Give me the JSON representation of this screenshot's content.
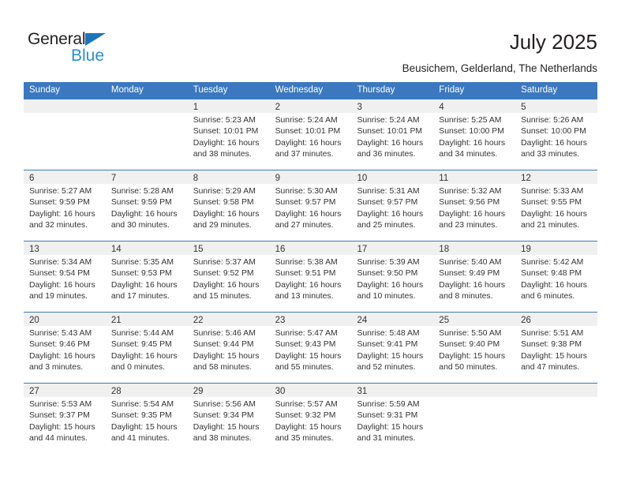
{
  "brand": {
    "name_part1": "General",
    "name_part2": "Blue",
    "color_dark": "#231f20",
    "color_blue": "#2a8fd4",
    "triangle_color": "#1b75bb"
  },
  "header": {
    "title": "July 2025",
    "subtitle": "Beusichem, Gelderland, The Netherlands",
    "accent_color": "#3b78bf",
    "daynum_strip_color": "#f0f0f0"
  },
  "weekday_headers": [
    "Sunday",
    "Monday",
    "Tuesday",
    "Wednesday",
    "Thursday",
    "Friday",
    "Saturday"
  ],
  "weeks": [
    [
      {
        "day": "",
        "sunrise": "",
        "sunset": "",
        "daylight_l1": "",
        "daylight_l2": "",
        "empty": true
      },
      {
        "day": "",
        "sunrise": "",
        "sunset": "",
        "daylight_l1": "",
        "daylight_l2": "",
        "empty": true
      },
      {
        "day": "1",
        "sunrise": "Sunrise: 5:23 AM",
        "sunset": "Sunset: 10:01 PM",
        "daylight_l1": "Daylight: 16 hours",
        "daylight_l2": "and 38 minutes.",
        "empty": false
      },
      {
        "day": "2",
        "sunrise": "Sunrise: 5:24 AM",
        "sunset": "Sunset: 10:01 PM",
        "daylight_l1": "Daylight: 16 hours",
        "daylight_l2": "and 37 minutes.",
        "empty": false
      },
      {
        "day": "3",
        "sunrise": "Sunrise: 5:24 AM",
        "sunset": "Sunset: 10:01 PM",
        "daylight_l1": "Daylight: 16 hours",
        "daylight_l2": "and 36 minutes.",
        "empty": false
      },
      {
        "day": "4",
        "sunrise": "Sunrise: 5:25 AM",
        "sunset": "Sunset: 10:00 PM",
        "daylight_l1": "Daylight: 16 hours",
        "daylight_l2": "and 34 minutes.",
        "empty": false
      },
      {
        "day": "5",
        "sunrise": "Sunrise: 5:26 AM",
        "sunset": "Sunset: 10:00 PM",
        "daylight_l1": "Daylight: 16 hours",
        "daylight_l2": "and 33 minutes.",
        "empty": false
      }
    ],
    [
      {
        "day": "6",
        "sunrise": "Sunrise: 5:27 AM",
        "sunset": "Sunset: 9:59 PM",
        "daylight_l1": "Daylight: 16 hours",
        "daylight_l2": "and 32 minutes.",
        "empty": false
      },
      {
        "day": "7",
        "sunrise": "Sunrise: 5:28 AM",
        "sunset": "Sunset: 9:59 PM",
        "daylight_l1": "Daylight: 16 hours",
        "daylight_l2": "and 30 minutes.",
        "empty": false
      },
      {
        "day": "8",
        "sunrise": "Sunrise: 5:29 AM",
        "sunset": "Sunset: 9:58 PM",
        "daylight_l1": "Daylight: 16 hours",
        "daylight_l2": "and 29 minutes.",
        "empty": false
      },
      {
        "day": "9",
        "sunrise": "Sunrise: 5:30 AM",
        "sunset": "Sunset: 9:57 PM",
        "daylight_l1": "Daylight: 16 hours",
        "daylight_l2": "and 27 minutes.",
        "empty": false
      },
      {
        "day": "10",
        "sunrise": "Sunrise: 5:31 AM",
        "sunset": "Sunset: 9:57 PM",
        "daylight_l1": "Daylight: 16 hours",
        "daylight_l2": "and 25 minutes.",
        "empty": false
      },
      {
        "day": "11",
        "sunrise": "Sunrise: 5:32 AM",
        "sunset": "Sunset: 9:56 PM",
        "daylight_l1": "Daylight: 16 hours",
        "daylight_l2": "and 23 minutes.",
        "empty": false
      },
      {
        "day": "12",
        "sunrise": "Sunrise: 5:33 AM",
        "sunset": "Sunset: 9:55 PM",
        "daylight_l1": "Daylight: 16 hours",
        "daylight_l2": "and 21 minutes.",
        "empty": false
      }
    ],
    [
      {
        "day": "13",
        "sunrise": "Sunrise: 5:34 AM",
        "sunset": "Sunset: 9:54 PM",
        "daylight_l1": "Daylight: 16 hours",
        "daylight_l2": "and 19 minutes.",
        "empty": false
      },
      {
        "day": "14",
        "sunrise": "Sunrise: 5:35 AM",
        "sunset": "Sunset: 9:53 PM",
        "daylight_l1": "Daylight: 16 hours",
        "daylight_l2": "and 17 minutes.",
        "empty": false
      },
      {
        "day": "15",
        "sunrise": "Sunrise: 5:37 AM",
        "sunset": "Sunset: 9:52 PM",
        "daylight_l1": "Daylight: 16 hours",
        "daylight_l2": "and 15 minutes.",
        "empty": false
      },
      {
        "day": "16",
        "sunrise": "Sunrise: 5:38 AM",
        "sunset": "Sunset: 9:51 PM",
        "daylight_l1": "Daylight: 16 hours",
        "daylight_l2": "and 13 minutes.",
        "empty": false
      },
      {
        "day": "17",
        "sunrise": "Sunrise: 5:39 AM",
        "sunset": "Sunset: 9:50 PM",
        "daylight_l1": "Daylight: 16 hours",
        "daylight_l2": "and 10 minutes.",
        "empty": false
      },
      {
        "day": "18",
        "sunrise": "Sunrise: 5:40 AM",
        "sunset": "Sunset: 9:49 PM",
        "daylight_l1": "Daylight: 16 hours",
        "daylight_l2": "and 8 minutes.",
        "empty": false
      },
      {
        "day": "19",
        "sunrise": "Sunrise: 5:42 AM",
        "sunset": "Sunset: 9:48 PM",
        "daylight_l1": "Daylight: 16 hours",
        "daylight_l2": "and 6 minutes.",
        "empty": false
      }
    ],
    [
      {
        "day": "20",
        "sunrise": "Sunrise: 5:43 AM",
        "sunset": "Sunset: 9:46 PM",
        "daylight_l1": "Daylight: 16 hours",
        "daylight_l2": "and 3 minutes.",
        "empty": false
      },
      {
        "day": "21",
        "sunrise": "Sunrise: 5:44 AM",
        "sunset": "Sunset: 9:45 PM",
        "daylight_l1": "Daylight: 16 hours",
        "daylight_l2": "and 0 minutes.",
        "empty": false
      },
      {
        "day": "22",
        "sunrise": "Sunrise: 5:46 AM",
        "sunset": "Sunset: 9:44 PM",
        "daylight_l1": "Daylight: 15 hours",
        "daylight_l2": "and 58 minutes.",
        "empty": false
      },
      {
        "day": "23",
        "sunrise": "Sunrise: 5:47 AM",
        "sunset": "Sunset: 9:43 PM",
        "daylight_l1": "Daylight: 15 hours",
        "daylight_l2": "and 55 minutes.",
        "empty": false
      },
      {
        "day": "24",
        "sunrise": "Sunrise: 5:48 AM",
        "sunset": "Sunset: 9:41 PM",
        "daylight_l1": "Daylight: 15 hours",
        "daylight_l2": "and 52 minutes.",
        "empty": false
      },
      {
        "day": "25",
        "sunrise": "Sunrise: 5:50 AM",
        "sunset": "Sunset: 9:40 PM",
        "daylight_l1": "Daylight: 15 hours",
        "daylight_l2": "and 50 minutes.",
        "empty": false
      },
      {
        "day": "26",
        "sunrise": "Sunrise: 5:51 AM",
        "sunset": "Sunset: 9:38 PM",
        "daylight_l1": "Daylight: 15 hours",
        "daylight_l2": "and 47 minutes.",
        "empty": false
      }
    ],
    [
      {
        "day": "27",
        "sunrise": "Sunrise: 5:53 AM",
        "sunset": "Sunset: 9:37 PM",
        "daylight_l1": "Daylight: 15 hours",
        "daylight_l2": "and 44 minutes.",
        "empty": false
      },
      {
        "day": "28",
        "sunrise": "Sunrise: 5:54 AM",
        "sunset": "Sunset: 9:35 PM",
        "daylight_l1": "Daylight: 15 hours",
        "daylight_l2": "and 41 minutes.",
        "empty": false
      },
      {
        "day": "29",
        "sunrise": "Sunrise: 5:56 AM",
        "sunset": "Sunset: 9:34 PM",
        "daylight_l1": "Daylight: 15 hours",
        "daylight_l2": "and 38 minutes.",
        "empty": false
      },
      {
        "day": "30",
        "sunrise": "Sunrise: 5:57 AM",
        "sunset": "Sunset: 9:32 PM",
        "daylight_l1": "Daylight: 15 hours",
        "daylight_l2": "and 35 minutes.",
        "empty": false
      },
      {
        "day": "31",
        "sunrise": "Sunrise: 5:59 AM",
        "sunset": "Sunset: 9:31 PM",
        "daylight_l1": "Daylight: 15 hours",
        "daylight_l2": "and 31 minutes.",
        "empty": false
      },
      {
        "day": "",
        "sunrise": "",
        "sunset": "",
        "daylight_l1": "",
        "daylight_l2": "",
        "empty": true
      },
      {
        "day": "",
        "sunrise": "",
        "sunset": "",
        "daylight_l1": "",
        "daylight_l2": "",
        "empty": true
      }
    ]
  ]
}
